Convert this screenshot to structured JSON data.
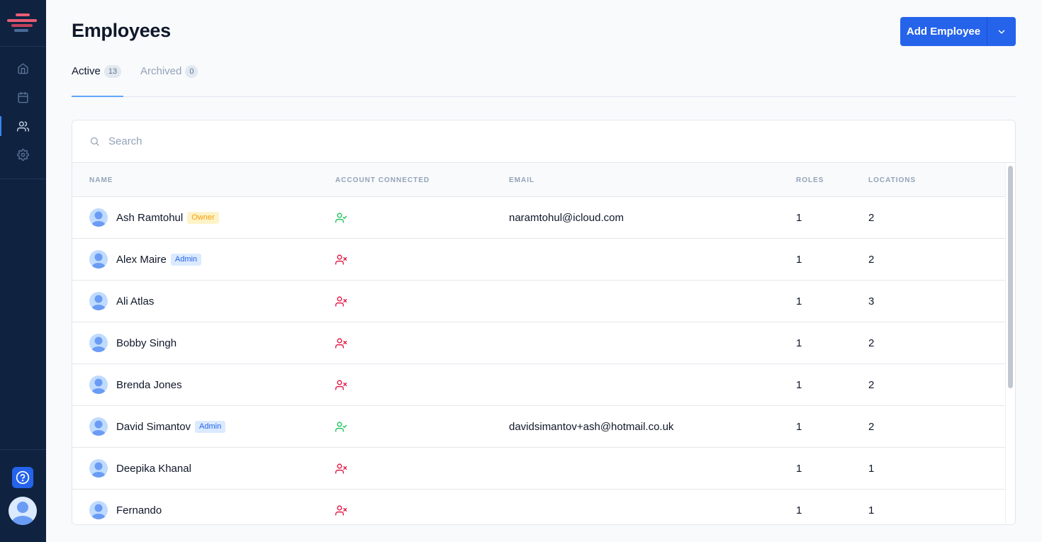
{
  "page": {
    "title": "Employees",
    "add_button_label": "Add Employee"
  },
  "colors": {
    "sidebar": "#0f2341",
    "primary": "#2563eb",
    "connected": "#22c55e",
    "not_connected": "#e11d48",
    "owner_badge": "#f59e0b",
    "admin_badge": "#2563eb"
  },
  "sidebar": {
    "items": [
      {
        "icon": "home-icon"
      },
      {
        "icon": "calendar-icon"
      },
      {
        "icon": "users-icon",
        "active": true
      },
      {
        "icon": "settings-icon"
      }
    ],
    "help_icon": "help-icon"
  },
  "tabs": [
    {
      "label": "Active",
      "count": "13"
    },
    {
      "label": "Archived",
      "count": "0"
    }
  ],
  "search": {
    "placeholder": "Search"
  },
  "table": {
    "columns": [
      "NAME",
      "ACCOUNT CONNECTED",
      "EMAIL",
      "ROLES",
      "LOCATIONS"
    ],
    "rows": [
      {
        "name": "Ash Ramtohul",
        "badge": "Owner",
        "connected": true,
        "email": "naramtohul@icloud.com",
        "roles": "1",
        "locations": "2"
      },
      {
        "name": "Alex Maire",
        "badge": "Admin",
        "connected": false,
        "email": "",
        "roles": "1",
        "locations": "2"
      },
      {
        "name": "Ali Atlas",
        "badge": "",
        "connected": false,
        "email": "",
        "roles": "1",
        "locations": "3"
      },
      {
        "name": "Bobby Singh",
        "badge": "",
        "connected": false,
        "email": "",
        "roles": "1",
        "locations": "2"
      },
      {
        "name": "Brenda Jones",
        "badge": "",
        "connected": false,
        "email": "",
        "roles": "1",
        "locations": "2"
      },
      {
        "name": "David Simantov",
        "badge": "Admin",
        "connected": true,
        "email": "davidsimantov+ash@hotmail.co.uk",
        "roles": "1",
        "locations": "2"
      },
      {
        "name": "Deepika Khanal",
        "badge": "",
        "connected": false,
        "email": "",
        "roles": "1",
        "locations": "1"
      },
      {
        "name": "Fernando",
        "badge": "",
        "connected": false,
        "email": "",
        "roles": "1",
        "locations": "1"
      }
    ]
  }
}
